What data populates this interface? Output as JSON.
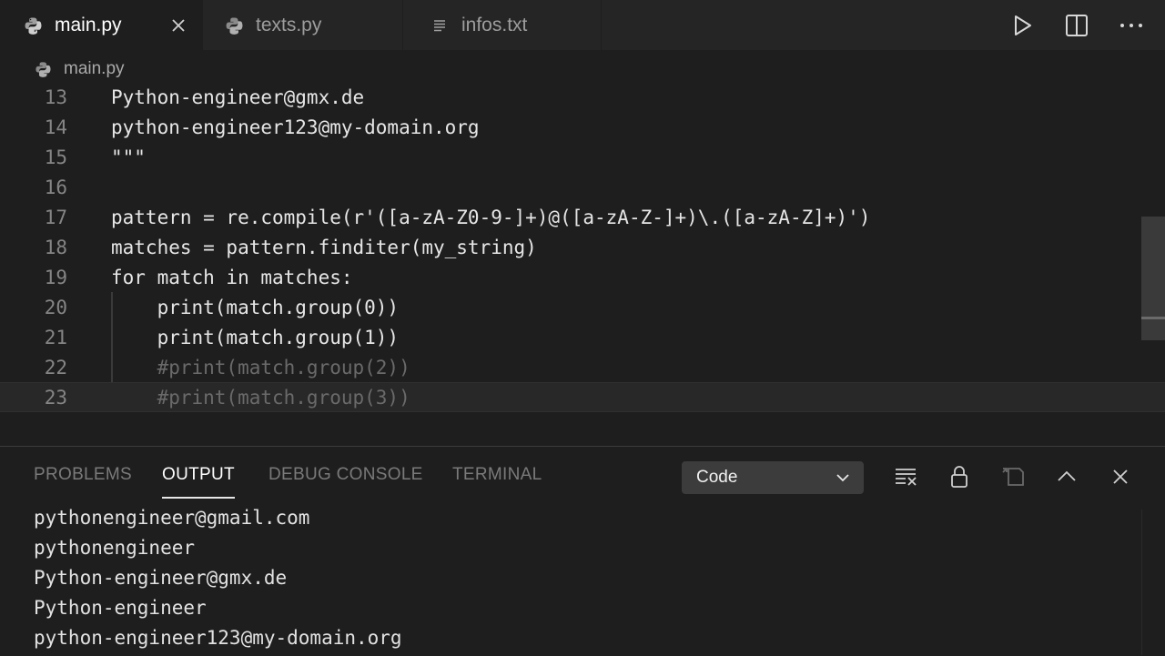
{
  "tabs": [
    {
      "label": "main.py",
      "icon": "python-file-icon",
      "active": true
    },
    {
      "label": "texts.py",
      "icon": "python-file-icon",
      "active": false
    },
    {
      "label": "infos.txt",
      "icon": "text-file-icon",
      "active": false
    }
  ],
  "breadcrumb": {
    "file": "main.py",
    "icon": "python-file-icon"
  },
  "editor": {
    "lines": [
      {
        "num": "13",
        "text": "Python-engineer@gmx.de"
      },
      {
        "num": "14",
        "text": "python-engineer123@my-domain.org"
      },
      {
        "num": "15",
        "text": "\"\"\""
      },
      {
        "num": "16",
        "text": ""
      },
      {
        "num": "17",
        "text": "pattern = re.compile(r'([a-zA-Z0-9-]+)@([a-zA-Z-]+)\\.([a-zA-Z]+)')"
      },
      {
        "num": "18",
        "text": "matches = pattern.finditer(my_string)"
      },
      {
        "num": "19",
        "text": "for match in matches:"
      },
      {
        "num": "20",
        "text": "    print(match.group(0))"
      },
      {
        "num": "21",
        "text": "    print(match.group(1))"
      },
      {
        "num": "22",
        "text": "    #print(match.group(2))"
      },
      {
        "num": "23",
        "text": "    #print(match.group(3))"
      }
    ],
    "current_line": "23"
  },
  "panel": {
    "tabs": [
      "PROBLEMS",
      "OUTPUT",
      "DEBUG CONSOLE",
      "TERMINAL"
    ],
    "active_tab": "OUTPUT",
    "channel": "Code",
    "output_lines": [
      "pythonengineer@gmail.com",
      "pythonengineer",
      "Python-engineer@gmx.de",
      "Python-engineer",
      "python-engineer123@my-domain.org"
    ]
  },
  "colors": {
    "background": "#1e1e1e",
    "tab_bar": "#252526",
    "dropdown": "#3c3c3c"
  }
}
